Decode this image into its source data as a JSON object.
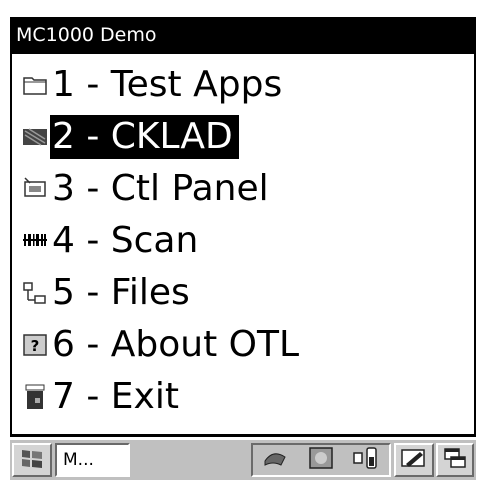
{
  "window": {
    "title": "MC1000 Demo"
  },
  "menu": {
    "items": [
      {
        "label": "1 - Test Apps",
        "icon": "folder-icon",
        "selected": false
      },
      {
        "label": "2 - CKLAD",
        "icon": "app-icon",
        "selected": true
      },
      {
        "label": "3 - Ctl Panel",
        "icon": "control-panel-icon",
        "selected": false
      },
      {
        "label": "4 - Scan",
        "icon": "barcode-icon",
        "selected": false
      },
      {
        "label": "5 - Files",
        "icon": "file-explorer-icon",
        "selected": false
      },
      {
        "label": "6 - About OTL",
        "icon": "help-icon",
        "selected": false
      },
      {
        "label": "7 - Exit",
        "icon": "exit-icon",
        "selected": false
      }
    ]
  },
  "taskbar": {
    "start_icon": "windows-flag-icon",
    "task_label": "M...",
    "tray_icons": [
      "connection-icon",
      "network-icon",
      "battery-icon"
    ],
    "input_icon": "input-panel-icon",
    "window_icon": "switch-window-icon"
  },
  "colors": {
    "title_bg": "#000000",
    "selection_bg": "#000000",
    "taskbar_bg": "#c0c0c0"
  }
}
